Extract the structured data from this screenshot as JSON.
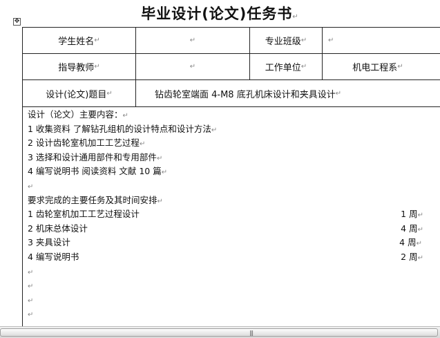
{
  "document": {
    "title": "毕业设计(论文)任务书",
    "paragraph_mark": "↵"
  },
  "table": {
    "row1": {
      "student_name_label": "学生姓名",
      "student_name_value": "",
      "class_label": "专业班级",
      "class_value": ""
    },
    "row2": {
      "advisor_label": "指导教师",
      "advisor_value": "",
      "work_unit_label": "工作单位",
      "work_unit_value": "机电工程系"
    },
    "row3": {
      "topic_label": "设计(论文)题目",
      "topic_value": "钻齿轮室端面 4-M8 底孔机床设计和夹具设计"
    },
    "main_content": {
      "heading": "设计（论文）主要内容：",
      "items": [
        "1 收集资料  了解钻孔组机的设计特点和设计方法",
        "2 设计齿轮室机加工工艺过程",
        "3 选择和设计通用部件和专用部件",
        "4 编写说明书  阅读资料  文献 10 篇"
      ]
    },
    "schedule": {
      "heading": "要求完成的主要任务及其时间安排",
      "tasks": [
        {
          "name": "1 齿轮室机加工工艺过程设计",
          "duration": "1 周"
        },
        {
          "name": "2 机床总体设计",
          "duration": "4 周"
        },
        {
          "name": "3  夹具设计",
          "duration": "4 周"
        },
        {
          "name": "4 编写说明书",
          "duration": "2 周"
        }
      ]
    }
  },
  "ui": {
    "table_move_handle_glyph": "✥",
    "scrollbar_grip_glyph": "|||"
  }
}
